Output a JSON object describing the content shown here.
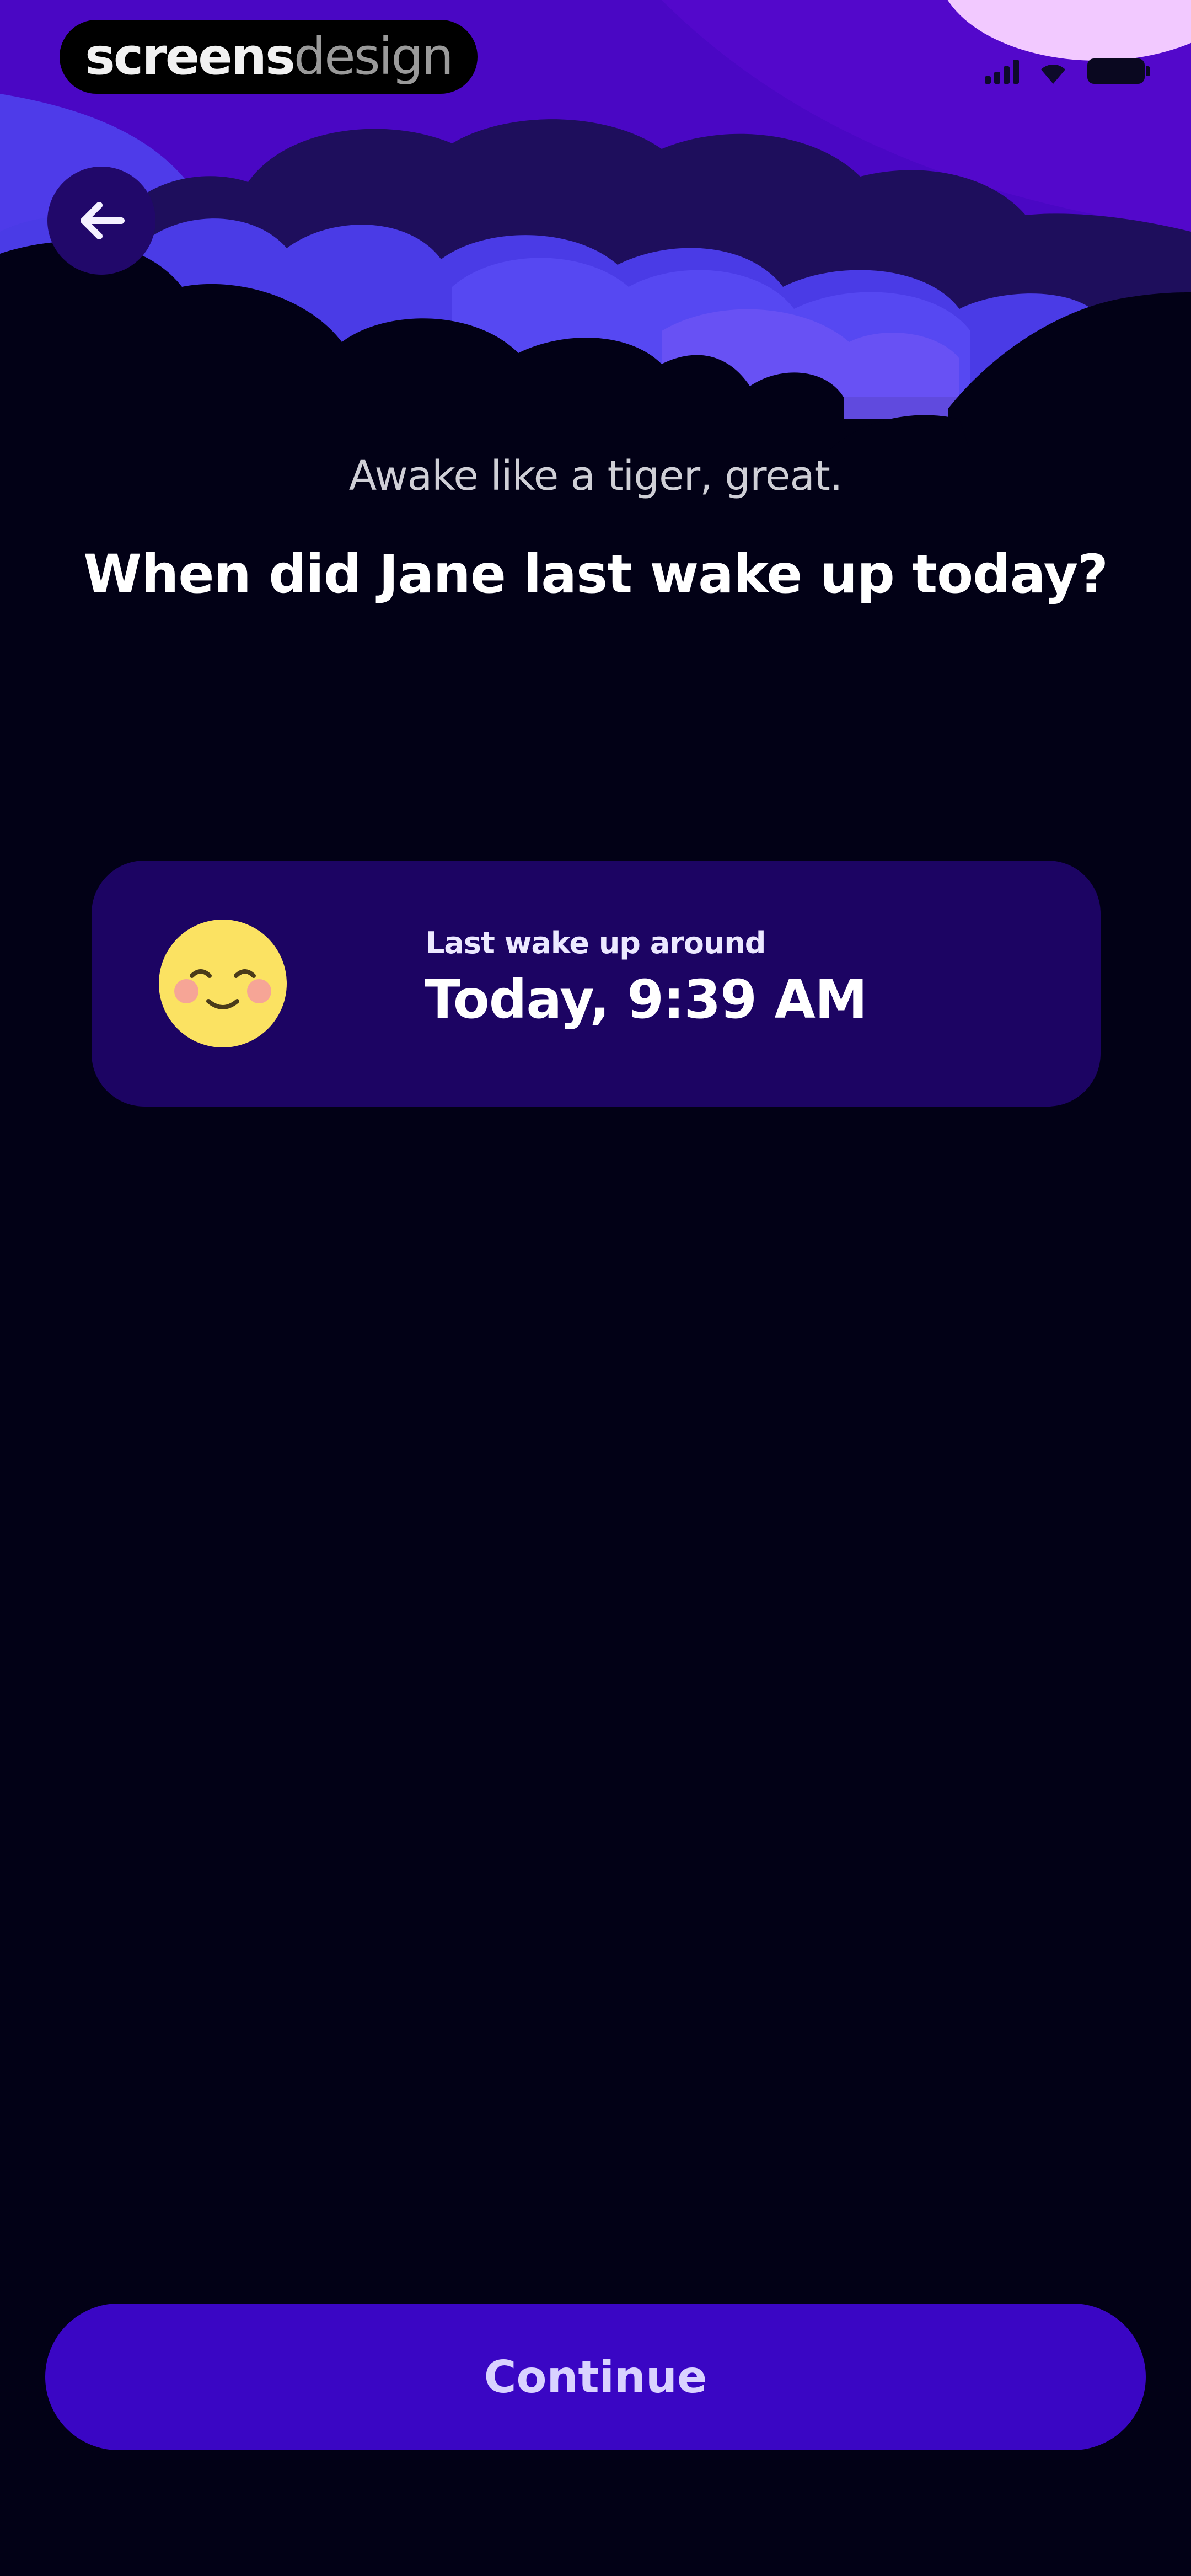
{
  "watermark": {
    "bold": "screens",
    "light": "design"
  },
  "subtitle": "Awake like a tiger, great.",
  "question": "When did Jane last wake up today?",
  "wake_card": {
    "label": "Last wake up around",
    "time": "Today, 9:39 AM"
  },
  "continue_label": "Continue",
  "colors": {
    "background": "#020116",
    "card": "#1c0463",
    "button": "#3a06c4",
    "sky_top": "#4a07c4",
    "cloud_light": "#4a3be6",
    "cloud_dark": "#1e0e5c",
    "moon": "#f2c9ff",
    "smiley": "#fbe262"
  },
  "icons": [
    "back-arrow-icon",
    "smiley-icon",
    "moon-icon",
    "signal-icon",
    "wifi-icon",
    "battery-icon"
  ]
}
